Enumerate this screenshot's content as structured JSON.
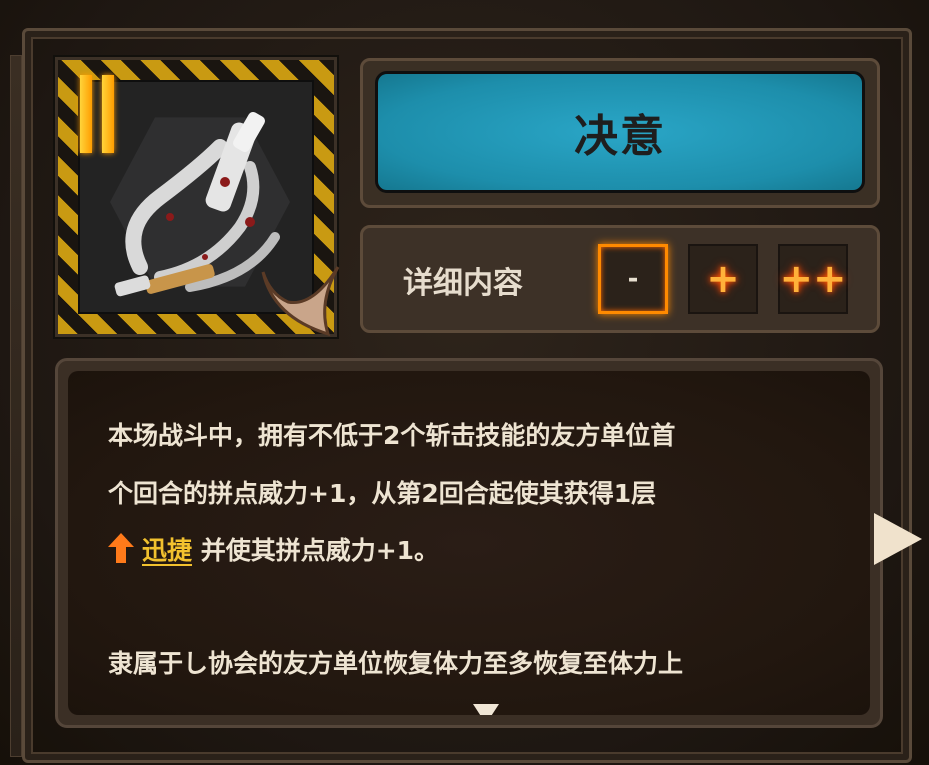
{
  "card": {
    "level_icon": "roman-numeral-two",
    "weapon_icon": "chainsaw-tool-icon",
    "title": "决意"
  },
  "detail": {
    "label": "详细内容",
    "levels": [
      {
        "label": "-",
        "selected": true
      },
      {
        "label": "+",
        "selected": false
      },
      {
        "label": "++",
        "selected": false
      }
    ]
  },
  "description": {
    "line1": "本场战斗中，拥有不低于2个斩击技能的友方单位首",
    "line2": "个回合的拼点威力+1，从第2回合起使其获得1层",
    "line3_keyword": "迅捷",
    "line3_rest": " 并使其拼点威力+1。",
    "line4": "隶属于し协会的友方单位恢复体力至多恢复至体力上"
  },
  "colors": {
    "title_bg": "#1d8eab",
    "keyword": "#f2c12e",
    "active_level": "#ff8a00",
    "hazard_yellow": "#c99a12"
  }
}
